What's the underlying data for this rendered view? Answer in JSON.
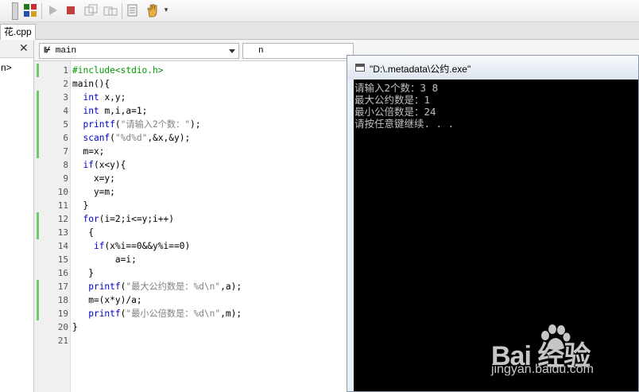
{
  "file_tab": {
    "name": "花.cpp"
  },
  "left_pane": {
    "close_glyph": "✕",
    "item": "n>"
  },
  "editor_header": {
    "scope": "main",
    "symbol": "n",
    "scope_icon": "⊮"
  },
  "code": {
    "line_numbers": [
      "1",
      "2",
      "3",
      "4",
      "5",
      "6",
      "7",
      "8",
      "9",
      "10",
      "11",
      "12",
      "13",
      "14",
      "15",
      "16",
      "17",
      "18",
      "19",
      "20",
      "21"
    ],
    "lines": [
      [
        {
          "t": "#include<stdio.h>",
          "c": "pp"
        }
      ],
      [
        {
          "t": "main(){",
          "c": "op"
        }
      ],
      [
        {
          "t": "  ",
          "c": "op"
        },
        {
          "t": "int",
          "c": "kw"
        },
        {
          "t": " x,y;",
          "c": "op"
        }
      ],
      [
        {
          "t": "  ",
          "c": "op"
        },
        {
          "t": "int",
          "c": "kw"
        },
        {
          "t": " m,i,a=1;",
          "c": "op"
        }
      ],
      [
        {
          "t": "  ",
          "c": "op"
        },
        {
          "t": "printf",
          "c": "kw"
        },
        {
          "t": "(",
          "c": "op"
        },
        {
          "t": "\"请输入2个数：\"",
          "c": "st"
        },
        {
          "t": ");",
          "c": "op"
        }
      ],
      [
        {
          "t": "  ",
          "c": "op"
        },
        {
          "t": "scanf",
          "c": "kw"
        },
        {
          "t": "(",
          "c": "op"
        },
        {
          "t": "\"%d%d\"",
          "c": "st"
        },
        {
          "t": ",&x,&y);",
          "c": "op"
        }
      ],
      [
        {
          "t": "  m=x;",
          "c": "op"
        }
      ],
      [
        {
          "t": "  ",
          "c": "op"
        },
        {
          "t": "if",
          "c": "kw"
        },
        {
          "t": "(x<y){",
          "c": "op"
        }
      ],
      [
        {
          "t": "    x=y;",
          "c": "op"
        }
      ],
      [
        {
          "t": "    y=m;",
          "c": "op"
        }
      ],
      [
        {
          "t": "  }",
          "c": "op"
        }
      ],
      [
        {
          "t": "  ",
          "c": "op"
        },
        {
          "t": "for",
          "c": "kw"
        },
        {
          "t": "(i=2;i<=y;i++)",
          "c": "op"
        }
      ],
      [
        {
          "t": "   {",
          "c": "op"
        }
      ],
      [
        {
          "t": "    ",
          "c": "op"
        },
        {
          "t": "if",
          "c": "kw"
        },
        {
          "t": "(x%i==0&&y%i==0)",
          "c": "op"
        }
      ],
      [
        {
          "t": "        a=i;",
          "c": "op"
        }
      ],
      [
        {
          "t": "   }",
          "c": "op"
        }
      ],
      [
        {
          "t": "   ",
          "c": "op"
        },
        {
          "t": "printf",
          "c": "kw"
        },
        {
          "t": "(",
          "c": "op"
        },
        {
          "t": "\"最大公约数是：%d\\n\"",
          "c": "st"
        },
        {
          "t": ",a);",
          "c": "op"
        }
      ],
      [
        {
          "t": "   m=(x*y)/a;",
          "c": "op"
        }
      ],
      [
        {
          "t": "   ",
          "c": "op"
        },
        {
          "t": "printf",
          "c": "kw"
        },
        {
          "t": "(",
          "c": "op"
        },
        {
          "t": "\"最小公倍数是：%d\\n\"",
          "c": "st"
        },
        {
          "t": ",m);",
          "c": "op"
        }
      ],
      [
        {
          "t": "}",
          "c": "op"
        }
      ],
      [
        {
          "t": "",
          "c": "op"
        }
      ]
    ]
  },
  "console": {
    "title": "\"D:\\.metadata\\公约.exe\"",
    "lines": [
      "请输入2个数：3 8",
      "最大公约数是：1",
      "最小公倍数是：24",
      "请按任意键继续. . ."
    ]
  },
  "watermark": {
    "brand": "Bai  经验",
    "url": "jingyan.baidu.com"
  },
  "colors": {
    "keyword": "#0000cc",
    "preprocessor": "#009900",
    "string": "#808080",
    "modified_bar": "#6ccc6c"
  }
}
